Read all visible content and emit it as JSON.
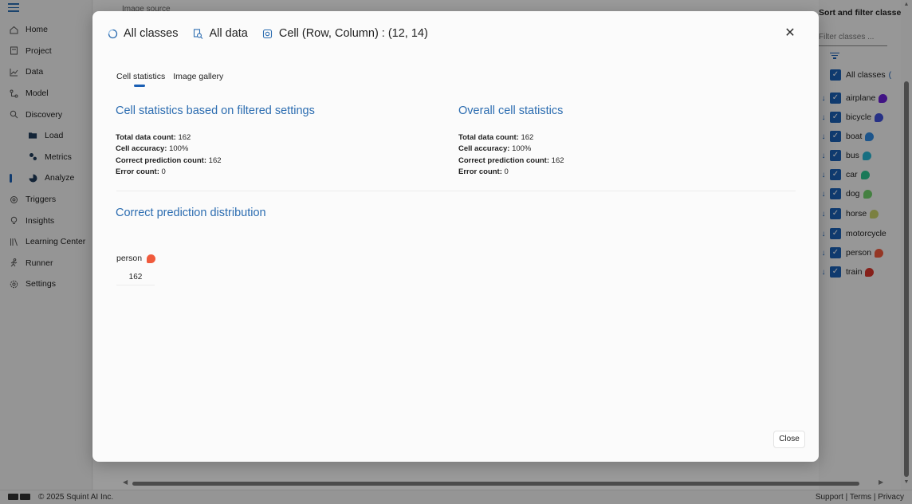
{
  "sidebar": {
    "items": [
      {
        "label": "Home",
        "icon": "home-icon"
      },
      {
        "label": "Project",
        "icon": "project-icon"
      },
      {
        "label": "Data",
        "icon": "data-chart-icon"
      },
      {
        "label": "Model",
        "icon": "model-icon"
      },
      {
        "label": "Discovery",
        "icon": "discovery-search-icon"
      },
      {
        "label": "Load",
        "icon": "folder-icon"
      },
      {
        "label": "Metrics",
        "icon": "metrics-gears-icon"
      },
      {
        "label": "Analyze",
        "icon": "analyze-icon"
      },
      {
        "label": "Triggers",
        "icon": "triggers-gear-icon"
      },
      {
        "label": "Insights",
        "icon": "lightbulb-icon"
      },
      {
        "label": "Learning Center",
        "icon": "library-icon"
      },
      {
        "label": "Runner",
        "icon": "runner-icon"
      },
      {
        "label": "Settings",
        "icon": "settings-icon"
      }
    ]
  },
  "main": {
    "title": "Image source"
  },
  "right_panel": {
    "title": "Sort and filter classes",
    "filter_placeholder": "Filter classes ...",
    "classes": [
      {
        "label": "All classes",
        "color": "#1a5fb4"
      },
      {
        "label": "airplane",
        "color": "#6a1fd6"
      },
      {
        "label": "bicycle",
        "color": "#3f4fd8"
      },
      {
        "label": "boat",
        "color": "#2f8ae0"
      },
      {
        "label": "bus",
        "color": "#26b3d0"
      },
      {
        "label": "car",
        "color": "#29c48e"
      },
      {
        "label": "dog",
        "color": "#6fcf6a"
      },
      {
        "label": "horse",
        "color": "#c7cf6a"
      },
      {
        "label": "motorcycle",
        "color": ""
      },
      {
        "label": "person",
        "color": "#f05a3c"
      },
      {
        "label": "train",
        "color": "#d8352a"
      }
    ]
  },
  "footer": {
    "copyright": "© 2025 Squint AI Inc.",
    "links": "Support | Terms | Privacy"
  },
  "modal": {
    "crumbs": {
      "all_classes": "All classes",
      "all_data": "All data",
      "cell": "Cell (Row, Column) : (12, 14)"
    },
    "tabs": [
      {
        "label": "Cell statistics",
        "active": true
      },
      {
        "label": "Image gallery",
        "active": false
      }
    ],
    "filtered": {
      "title": "Cell statistics based on filtered settings",
      "total_label": "Total data count:",
      "total_value": "162",
      "acc_label": "Cell accuracy:",
      "acc_value": "100%",
      "correct_label": "Correct prediction count:",
      "correct_value": "162",
      "error_label": "Error count:",
      "error_value": "0"
    },
    "overall": {
      "title": "Overall cell statistics",
      "total_label": "Total data count:",
      "total_value": "162",
      "acc_label": "Cell accuracy:",
      "acc_value": "100%",
      "correct_label": "Correct prediction count:",
      "correct_value": "162",
      "error_label": "Error count:",
      "error_value": "0"
    },
    "distribution": {
      "title": "Correct prediction distribution",
      "class_label": "person",
      "class_color": "#f05a3c",
      "count": "162"
    },
    "close_label": "Close"
  }
}
